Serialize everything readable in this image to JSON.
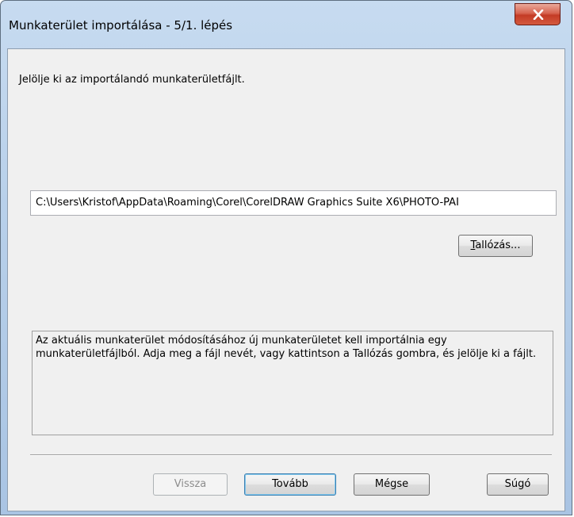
{
  "window": {
    "title": "Munkaterület importálása - 5/1. lépés",
    "close_icon": "close-icon"
  },
  "content": {
    "instruction": "Jelölje ki az importálandó munkaterületfájlt.",
    "path_value": "C:\\Users\\Kristof\\AppData\\Roaming\\Corel\\CorelDRAW Graphics Suite X6\\PHOTO-PAI",
    "browse_accel": "T",
    "browse_rest": "allózás...",
    "description": "Az aktuális munkaterület módosításához új munkaterületet kell importálnia egy munkaterületfájlból. Adja meg a fájl nevét, vagy kattintson a Tallózás gombra, és jelölje ki a fájlt."
  },
  "buttons": {
    "back": "Vissza",
    "next": "Tovább",
    "cancel": "Mégse",
    "help": "Súgó"
  },
  "colors": {
    "frame": "#b8d0ea",
    "close_button": "#c43b26",
    "dialog_bg": "#f0f0f0"
  }
}
